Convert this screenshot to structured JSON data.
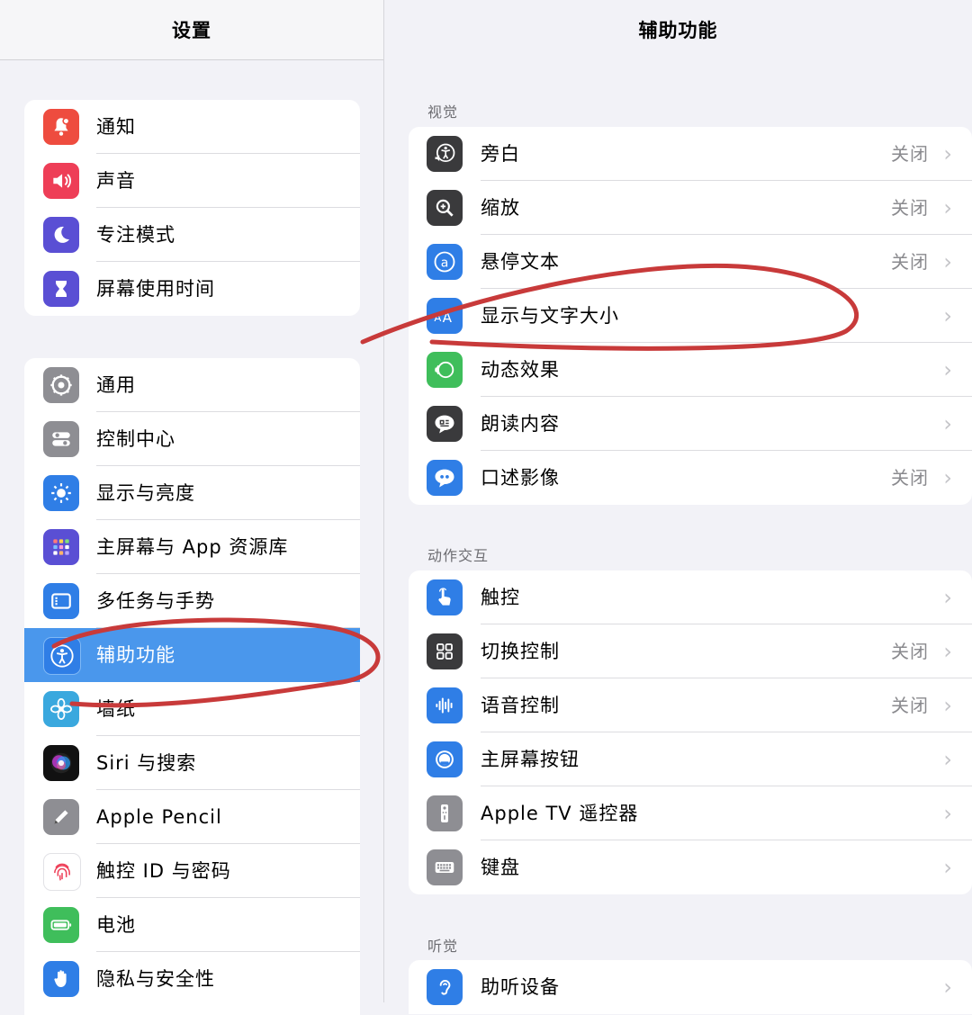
{
  "left": {
    "title": "设置",
    "group1": [
      {
        "label": "通知",
        "icon": "bell-icon",
        "color": "#ee4c3f"
      },
      {
        "label": "声音",
        "icon": "speaker-icon",
        "color": "#ee3e57"
      },
      {
        "label": "专注模式",
        "icon": "moon-icon",
        "color": "#5a4fd4"
      },
      {
        "label": "屏幕使用时间",
        "icon": "hourglass-icon",
        "color": "#5a4fd4"
      }
    ],
    "group2": [
      {
        "label": "通用",
        "icon": "gear-icon",
        "color": "#8e8e93"
      },
      {
        "label": "控制中心",
        "icon": "toggles-icon",
        "color": "#8e8e93"
      },
      {
        "label": "显示与亮度",
        "icon": "sun-icon",
        "color": "#2f7ee6"
      },
      {
        "label": "主屏幕与 App 资源库",
        "icon": "app-grid-icon",
        "color": "#5a4fd4"
      },
      {
        "label": "多任务与手势",
        "icon": "multitask-icon",
        "color": "#2f7ee6"
      },
      {
        "label": "辅助功能",
        "icon": "accessibility-icon",
        "color": "#2f7ee6",
        "selected": true
      },
      {
        "label": "墙纸",
        "icon": "flower-icon",
        "color": "#3aa8de"
      },
      {
        "label": "Siri 与搜索",
        "icon": "siri-icon",
        "color": "#222233"
      },
      {
        "label": "Apple Pencil",
        "icon": "pencil-icon",
        "color": "#8e8e93"
      },
      {
        "label": "触控 ID 与密码",
        "icon": "fingerprint-icon",
        "color": "#ffffff"
      },
      {
        "label": "电池",
        "icon": "battery-icon",
        "color": "#3fbe5b"
      },
      {
        "label": "隐私与安全性",
        "icon": "hand-icon",
        "color": "#2f7ee6"
      }
    ]
  },
  "right": {
    "title": "辅助功能",
    "sections": [
      {
        "label": "视觉",
        "rows": [
          {
            "label": "旁白",
            "status": "关闭",
            "icon": "voiceover-icon",
            "color": "#3a3a3c"
          },
          {
            "label": "缩放",
            "status": "关闭",
            "icon": "zoom-icon",
            "color": "#3a3a3c"
          },
          {
            "label": "悬停文本",
            "status": "关闭",
            "icon": "hover-text-icon",
            "color": "#2f7ee6"
          },
          {
            "label": "显示与文字大小",
            "status": "",
            "icon": "text-size-icon",
            "color": "#2f7ee6"
          },
          {
            "label": "动态效果",
            "status": "",
            "icon": "motion-icon",
            "color": "#3fbe5b"
          },
          {
            "label": "朗读内容",
            "status": "",
            "icon": "speech-bubble-icon",
            "color": "#3a3a3c"
          },
          {
            "label": "口述影像",
            "status": "关闭",
            "icon": "audio-description-icon",
            "color": "#2f7ee6"
          }
        ]
      },
      {
        "label": "动作交互",
        "rows": [
          {
            "label": "触控",
            "status": "",
            "icon": "touch-hand-icon",
            "color": "#2f7ee6"
          },
          {
            "label": "切换控制",
            "status": "关闭",
            "icon": "switch-grid-icon",
            "color": "#3a3a3c"
          },
          {
            "label": "语音控制",
            "status": "关闭",
            "icon": "voice-wave-icon",
            "color": "#2f7ee6"
          },
          {
            "label": "主屏幕按钮",
            "status": "",
            "icon": "home-button-icon",
            "color": "#2f7ee6"
          },
          {
            "label": "Apple TV 遥控器",
            "status": "",
            "icon": "remote-icon",
            "color": "#8e8e93"
          },
          {
            "label": "键盘",
            "status": "",
            "icon": "keyboard-icon",
            "color": "#8e8e93"
          }
        ]
      },
      {
        "label": "听觉",
        "rows": [
          {
            "label": "助听设备",
            "status": "",
            "icon": "ear-icon",
            "color": "#2f7ee6"
          }
        ]
      }
    ]
  },
  "annotation_color": "#c83a3a",
  "selection_color": "#4a97ec",
  "chevron_glyph": "›"
}
